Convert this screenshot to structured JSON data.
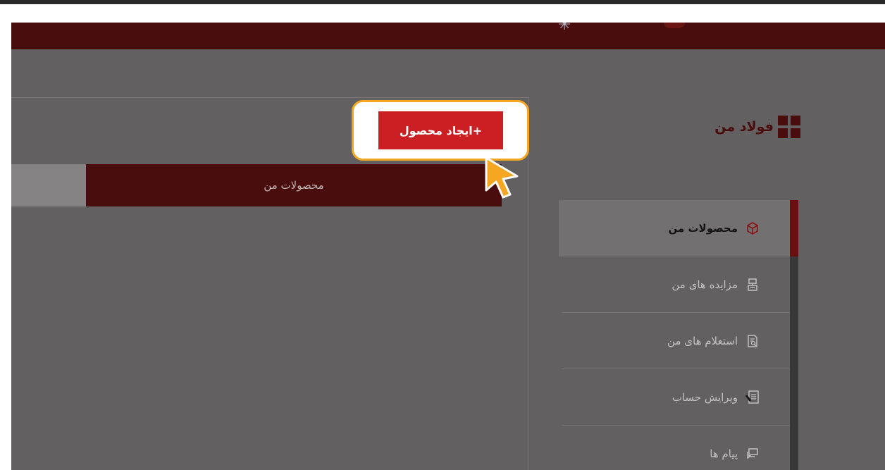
{
  "create_button": {
    "label": "+ایجاد محصول"
  },
  "brand": {
    "title": "فولاد من"
  },
  "tabs": [
    {
      "label": "محصولات من",
      "active": true
    }
  ],
  "sidebar": {
    "items": [
      {
        "label": "محصولات من",
        "icon": "cube-icon",
        "active": true
      },
      {
        "label": "مزایده های من",
        "icon": "auction-icon",
        "active": false
      },
      {
        "label": "استعلام های من",
        "icon": "document-search-icon",
        "active": false
      },
      {
        "label": "ویرایش حساب",
        "icon": "edit-document-icon",
        "active": false
      },
      {
        "label": "پیام ها",
        "icon": "chat-icon",
        "active": false
      }
    ]
  },
  "colors": {
    "primary": "#cc1f24",
    "dark_red": "#4a0d0d",
    "highlight": "#f5a623",
    "overlay": "#626061"
  }
}
